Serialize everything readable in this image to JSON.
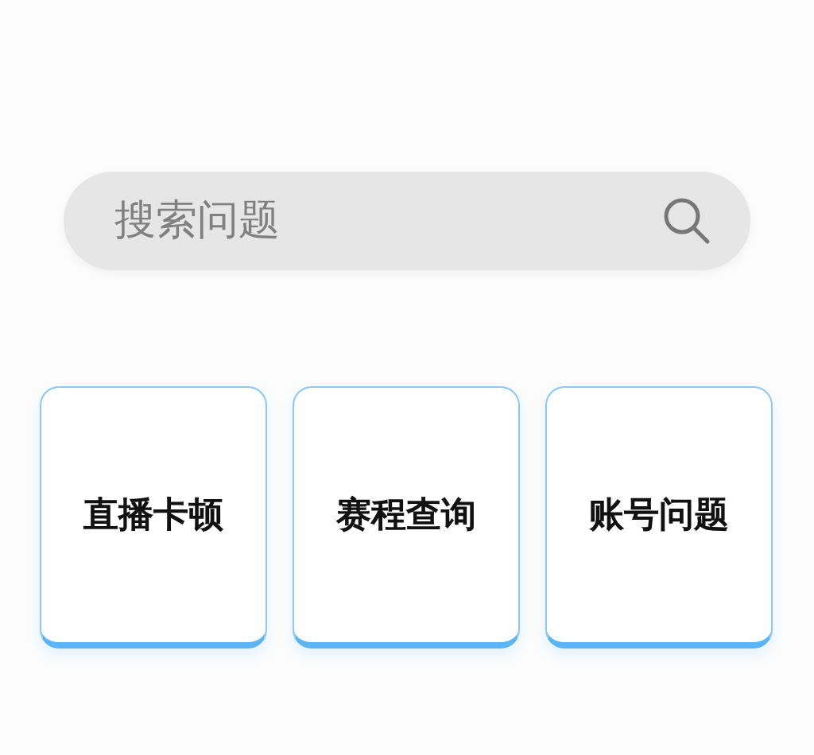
{
  "search": {
    "placeholder": "搜索问题"
  },
  "categories": [
    {
      "label": "直播卡顿"
    },
    {
      "label": "赛程查询"
    },
    {
      "label": "账号问题"
    }
  ]
}
